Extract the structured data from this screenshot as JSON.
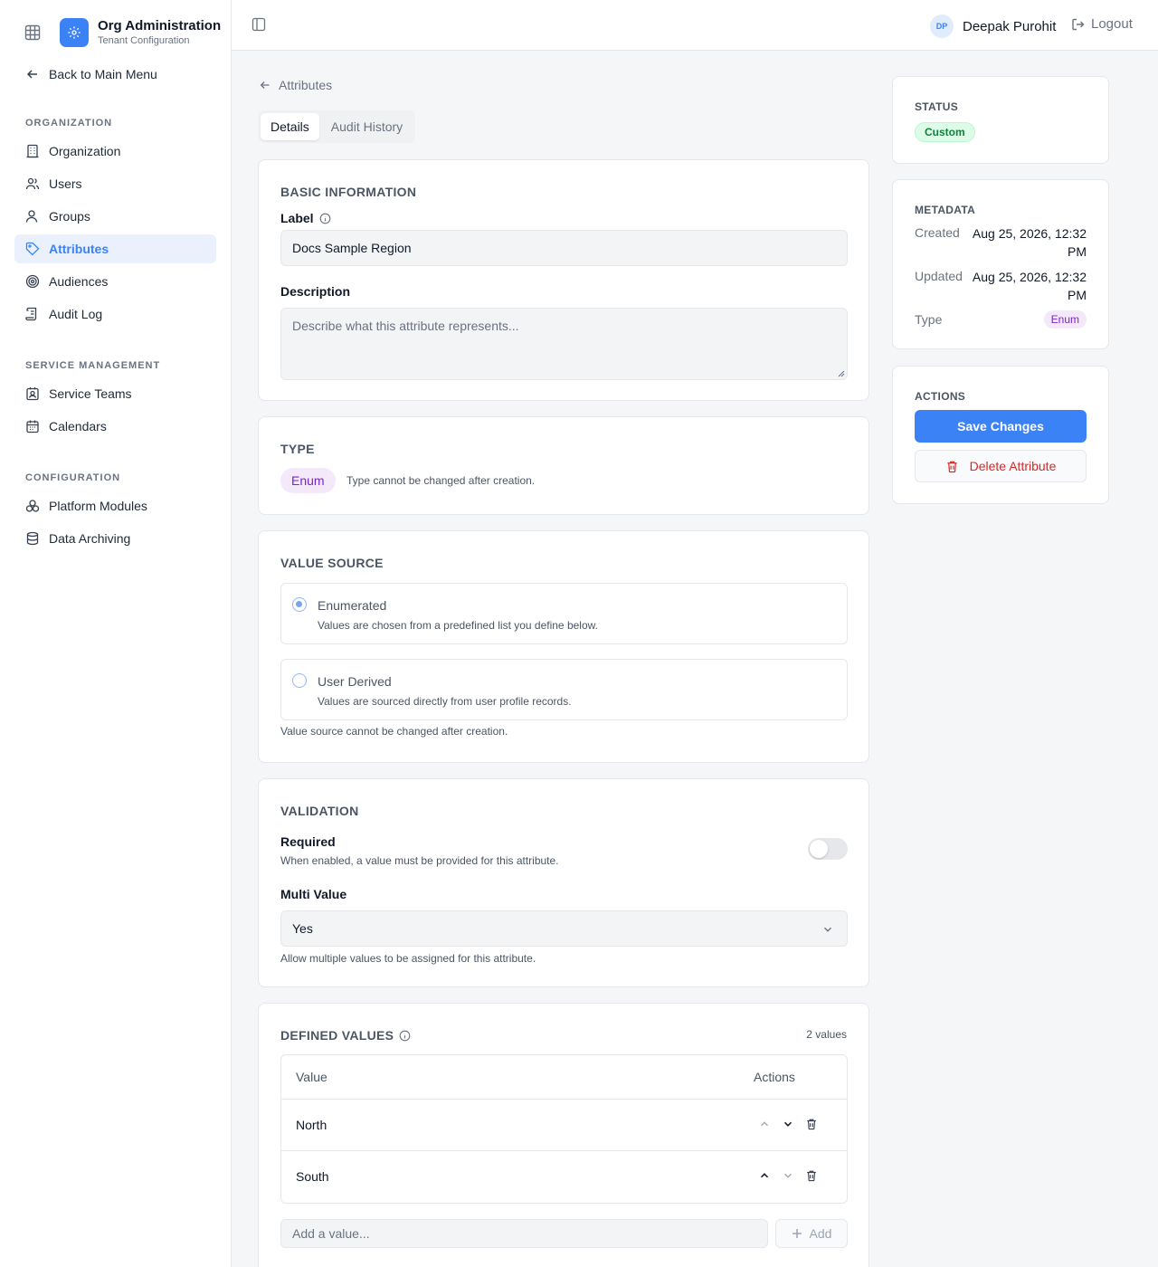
{
  "app": {
    "title": "Org Administration",
    "subtitle": "Tenant Configuration",
    "accent": "#3b82f6"
  },
  "sidebar": {
    "back_label": "Back to Main Menu",
    "sections": [
      {
        "label": "ORGANIZATION",
        "items": [
          {
            "label": "Organization",
            "icon": "building-icon"
          },
          {
            "label": "Users",
            "icon": "users-icon"
          },
          {
            "label": "Groups",
            "icon": "group-icon"
          },
          {
            "label": "Attributes",
            "icon": "tag-icon",
            "active": true
          },
          {
            "label": "Audiences",
            "icon": "target-icon"
          },
          {
            "label": "Audit Log",
            "icon": "scroll-icon"
          }
        ]
      },
      {
        "label": "SERVICE MANAGEMENT",
        "items": [
          {
            "label": "Service Teams",
            "icon": "contact-icon"
          },
          {
            "label": "Calendars",
            "icon": "calendar-icon"
          }
        ]
      },
      {
        "label": "CONFIGURATION",
        "items": [
          {
            "label": "Platform Modules",
            "icon": "modules-icon"
          },
          {
            "label": "Data Archiving",
            "icon": "database-icon"
          }
        ]
      }
    ]
  },
  "topbar": {
    "user_initials": "DP",
    "user_name": "Deepak Purohit",
    "logout_label": "Logout"
  },
  "breadcrumb": {
    "label": "Attributes"
  },
  "tabs": [
    {
      "label": "Details",
      "active": true
    },
    {
      "label": "Audit History",
      "active": false
    }
  ],
  "basic_info": {
    "title": "BASIC INFORMATION",
    "label_label": "Label",
    "label_value": "Docs Sample Region",
    "description_label": "Description",
    "description_placeholder": "Describe what this attribute represents..."
  },
  "type_card": {
    "title": "TYPE",
    "value": "Enum",
    "note": "Type cannot be changed after creation."
  },
  "value_source": {
    "title": "VALUE SOURCE",
    "options": [
      {
        "label": "Enumerated",
        "description": "Values are chosen from a predefined list you define below.",
        "selected": true
      },
      {
        "label": "User Derived",
        "description": "Values are sourced directly from user profile records.",
        "selected": false
      }
    ],
    "note": "Value source cannot be changed after creation."
  },
  "validation": {
    "title": "VALIDATION",
    "required_label": "Required",
    "required_help": "When enabled, a value must be provided for this attribute.",
    "required_enabled": false,
    "multi_label": "Multi Value",
    "multi_value": "Yes",
    "multi_help": "Allow multiple values to be assigned for this attribute."
  },
  "defined_values": {
    "title": "DEFINED VALUES",
    "count_label": "2 values",
    "columns": [
      "Value",
      "Actions"
    ],
    "rows": [
      {
        "value": "North"
      },
      {
        "value": "South"
      }
    ],
    "add_placeholder": "Add a value...",
    "add_label": "Add"
  },
  "status_card": {
    "title": "STATUS",
    "badge": "Custom"
  },
  "metadata": {
    "title": "METADATA",
    "created_label": "Created",
    "created_value": "Aug 25, 2026, 12:32 PM",
    "updated_label": "Updated",
    "updated_value": "Aug 25, 2026, 12:32 PM",
    "type_label": "Type",
    "type_value": "Enum"
  },
  "actions": {
    "title": "ACTIONS",
    "save_label": "Save Changes",
    "delete_label": "Delete Attribute"
  }
}
